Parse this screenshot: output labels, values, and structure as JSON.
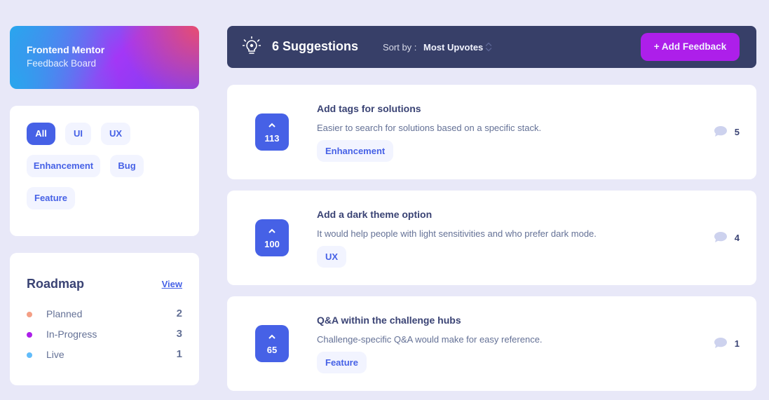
{
  "brand": {
    "title": "Frontend Mentor",
    "subtitle": "Feedback Board"
  },
  "filters": [
    {
      "label": "All",
      "active": true
    },
    {
      "label": "UI",
      "active": false
    },
    {
      "label": "UX",
      "active": false
    },
    {
      "label": "Enhancement",
      "active": false
    },
    {
      "label": "Bug",
      "active": false
    },
    {
      "label": "Feature",
      "active": false
    }
  ],
  "roadmap": {
    "title": "Roadmap",
    "view_label": "View",
    "items": [
      {
        "label": "Planned",
        "count": "2",
        "color": "#f49f85"
      },
      {
        "label": "In-Progress",
        "count": "3",
        "color": "#ad1fea"
      },
      {
        "label": "Live",
        "count": "1",
        "color": "#62bcfa"
      }
    ]
  },
  "header": {
    "icon": "lightbulb-icon",
    "suggestions_label": "6 Suggestions",
    "sort_label": "Sort by :",
    "sort_value": "Most Upvotes",
    "add_button": "+ Add Feedback"
  },
  "feedback": [
    {
      "upvotes": "113",
      "title": "Add tags for solutions",
      "description": "Easier to search for solutions based on a specific stack.",
      "tag": "Enhancement",
      "comments": "5"
    },
    {
      "upvotes": "100",
      "title": "Add a dark theme option",
      "description": "It would help people with light sensitivities and who prefer dark mode.",
      "tag": "UX",
      "comments": "4"
    },
    {
      "upvotes": "65",
      "title": "Q&A within the challenge hubs",
      "description": "Challenge-specific Q&A would make for easy reference.",
      "tag": "Feature",
      "comments": "1"
    }
  ],
  "colors": {
    "accent": "#4661e6",
    "purple": "#ad1fea",
    "navy": "#373f68",
    "background": "#e8e8f8"
  }
}
